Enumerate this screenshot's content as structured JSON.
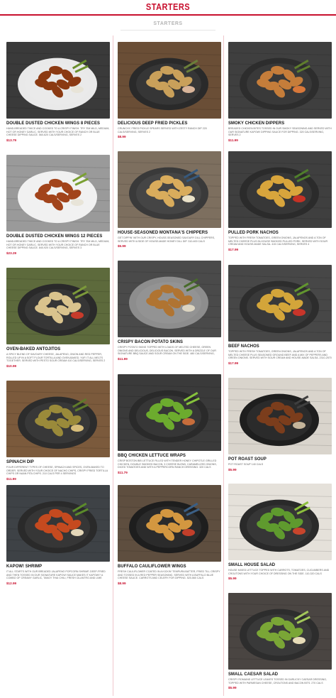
{
  "header": {
    "title": "STARTERS",
    "subtitle": "STARTERS"
  },
  "columns": [
    [
      {
        "name": "DOUBLE DUSTED CHICKEN WINGS 8 PIECES",
        "desc": "HAND-BREADED TWICE AND COOKED TO A CRISPY FINISH. TRY 'EM MILD, MEDIUM, HOT OR HONEY GARLIC. SERVED WITH YOUR CHOICE OF RANCH OR BLUE CHEESE DIPPING SAUCE. 560-620 CALS/SERVING, SERVES 2",
        "price": "$13.79",
        "photo": "wings"
      },
      {
        "name": "DOUBLE DUSTED CHICKEN WINGS 12 PIECES",
        "desc": "HAND-BREADED TWICE AND COOKED TO A CRISPY FINISH. TRY 'EM MILD, MEDIUM, HOT OR HONEY GARLIC. SERVED WITH YOUR CHOICE OF RANCH OR BLUE CHEESE DIPPING SAUCE. 840-920 CALS/SERVING, SERVES 3",
        "price": "$23.29",
        "photo": "wings2"
      },
      {
        "name": "OVEN-BAKED ANTOJITOS",
        "desc": "A SPICY BLEND OF SAVOURY CHEESE, JALAPENO, ONION AND RED PEPPER, ROLLED UP IN A SOFT FLOUR TORTILLA AND OVEN-BAKED. YUP, IT ALL MELTS TOGETHER. SERVED WITH PESTO SOUR CREAM 410 CALS/SERVING, SERVES 2",
        "price": "$10.99",
        "photo": "antojitos"
      },
      {
        "name": "SPINACH DIP",
        "desc": "FOUR DIFFERENT TYPES OF CHEESE, SPINACH AND SPICES, OVEN-BAKED TO ORDER. SERVED WITH YOUR CHOICE OF NACHO CHIPS, CRISPY FRIED TORTILLA CHIPS OR NAAN PITA CHIPS. 210 CALS PER 4 SERVINGS",
        "price": "$11.99",
        "photo": "dip"
      },
      {
        "name": "KAPOW! SHRIMP",
        "desc": "IT ALL STARTS WITH OUR BREADED JALAPENO POPCORN SHRIMP, DEEP-FRIED AND THEN TOSSED IN OUR SIGNATURE KAPOW! SAUCE MAKES IT KAPOW!? A COMBO OF CREAMY GARLIC, TANGY THAI CHILI, FRESH CILANTRO AND LIME JUICE 410 CALS/SERVING, SERVES 2",
        "price": "$12.99",
        "photo": "shrimp"
      }
    ],
    [
      {
        "name": "DELICIOUS DEEP FRIED PICKLES",
        "desc": "CRUNCHY, FRIED PICKLE SPEARS SERVED WITH ZESTY RANCH DIP 220 CALS/SERVING, SERVES 2",
        "price": "$8.99",
        "photo": "pickles"
      },
      {
        "name": "HOUSE-SEASONED MONTANA'S CHIPPERS",
        "desc": "GET DIPPIN' WITH OUR CRISPY, HOUSE-SEASONED SAVOURY DILL CHIPPERS, SERVED WITH A SIDE OF HOUSE-MADE HONEY DILL DIP. 310-400 CALS",
        "price": "$5.99",
        "photo": "chips"
      },
      {
        "name": "CRISPY BACON POTATO SKINS",
        "desc": "CRISPY POTATO SKINS TOPPED WITH LOADS OF MELTED CHEESE, GREEN ONIONS AND DELICIOUS, DELICIOUS BACON. SERVED WITH A DRIZZLE OF OUR SIGNATURE BBQ SAUCE AND SOUR CREAM ON THE SIDE. 480 CALS/SERVING, SERVES 2",
        "price": "$11.99",
        "photo": "skins"
      },
      {
        "name": "BBQ CHICKEN LETTUCE WRAPS",
        "desc": "CRISP BOSTON BIB LETTUCE FILLED WITH TENDER HONEY CHIPOTLE GRILLED CHICKEN, DOUBLE SMOKED BACON, 3 CHEESE BLEND, CARAMELIZED ONIONS, DICED TOMATOES AND WITH A PEPPERCORN RANCH DRESSING. 320 CALS",
        "price": "$11.79",
        "photo": "wraps"
      },
      {
        "name": "BUFFALO CAULIFLOWER WINGS",
        "desc": "FRESH CAULIFLOWER COATED IN A KICKIN' TEMPURA BATTER, FRIED TILL CRISPY AND TOSSED IN A RED PEPPER SEASONING. SERVED WITH A BUFFALO BLUE CHEESE SAUCE. CARROTS AND CELERY FOR DIPPING. 520-560 CALS",
        "price": "$8.99",
        "photo": "cauli"
      }
    ],
    [
      {
        "name": "SMOKY CHICKEN DIPPERS",
        "desc": "BREADED CHICKEN BITES TOSSED IN OUR SMOKY SEASONING AND SERVED WITH OUR SIGNATURE KAPOW! DIPPING SAUCE FOR DIPPING. 320 CALS/SERVING, SERVES 2",
        "price": "$11.99",
        "photo": "dippers"
      },
      {
        "name": "PULLED PORK NACHOS",
        "desc": "TOPPED WITH FRESH TOMATOES, GREEN ONIONS, JALAPENOS AND A TON OF MELTED CHEESE PLUS IN-HOUSE SMOKED PULLED PORK. SERVED WITH SOUR CREAM AND HOUSE-MADE SALSA. 415 CALS/SERVING, SERVES 4",
        "price": "$17.99",
        "photo": "nachos"
      },
      {
        "name": "BEEF NACHOS",
        "desc": "TOPPED WITH FRESH TOMATOES, GREEN ONIONS, JALAPENOS AND A TON OF MELTED CHEESE PLUS SEASONED GROUND BEEF AND A MIX OF PEPPERS AND GREEN ONIONS. SERVED WITH SOUR CREAM AND HOUSE-MADE SALSA. 2310-2570 CALS, SERVES 4",
        "price": "$17.99",
        "photo": "nachos2"
      },
      {
        "name": "POT ROAST SOUP",
        "desc": "POT ROAST SOUP 140 CALS",
        "price": "$5.99",
        "photo": "soup"
      },
      {
        "name": "SMALL HOUSE SALAD",
        "desc": "HOUSE MIXED LETTUCE TOPPED WITH CARROTS, TOMATOES, CUCUMBERS AND CROUTONS WITH YOUR CHOICE OF DRESSING ON THE SIDE. 110-320 CALS",
        "price": "$5.99",
        "photo": "salad"
      },
      {
        "name": "SMALL CAESAR SALAD",
        "desc": "CRISPY ROMAINE LETTUCE LEAVES TOSSED IN GARLICKY CAESAR DRESSING, TOPPED WITH PARMESAN CHEESE, CROUTONS AND BACON BITS. 270 CALS",
        "price": "$5.99",
        "photo": "caesar"
      }
    ]
  ]
}
